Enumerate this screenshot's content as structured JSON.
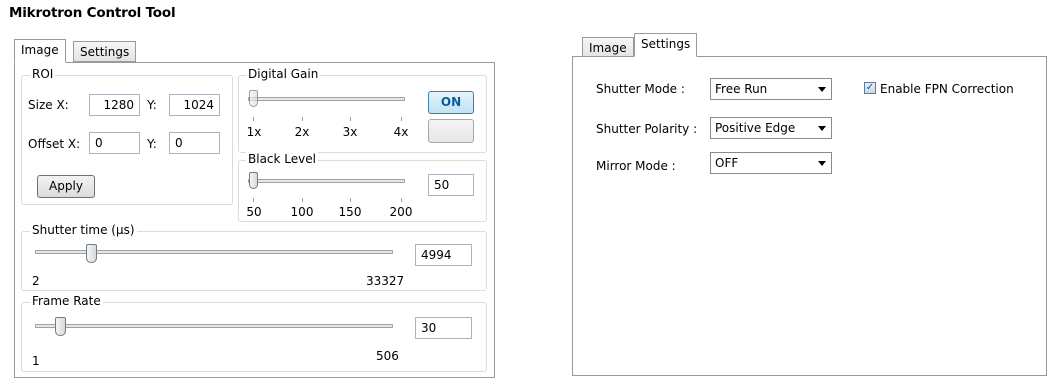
{
  "app_title": "Mikrotron Control Tool",
  "left_tabs": [
    "Image",
    "Settings"
  ],
  "right_tabs": [
    "Image",
    "Settings"
  ],
  "roi": {
    "group_label": "ROI",
    "size_x_label": "Size X:",
    "size_x_value": "1280",
    "y_label": "Y:",
    "size_y_value": "1024",
    "offset_x_label": "Offset X:",
    "offset_x_value": "0",
    "offset_y_label": "Y:",
    "offset_y_value": "0",
    "apply_label": "Apply"
  },
  "digital_gain": {
    "group_label": "Digital Gain",
    "ticks": [
      "1x",
      "2x",
      "3x",
      "4x"
    ],
    "level": 0,
    "on_label": "ON"
  },
  "black_level": {
    "group_label": "Black Level",
    "ticks": [
      "50",
      "100",
      "150",
      "200"
    ],
    "value": "50"
  },
  "shutter_time": {
    "group_label": "Shutter time (µs)",
    "min": "2",
    "max": "33327",
    "value": "4994"
  },
  "frame_rate": {
    "group_label": "Frame Rate",
    "min": "1",
    "max": "506",
    "value": "30"
  },
  "settings": {
    "shutter_mode_label": "Shutter Mode :",
    "shutter_mode_value": "Free Run",
    "shutter_polarity_label": "Shutter Polarity :",
    "shutter_polarity_value": "Positive Edge",
    "mirror_mode_label": "Mirror Mode :",
    "mirror_mode_value": "OFF",
    "fpn_label": "Enable FPN Correction",
    "fpn_checked": true
  }
}
